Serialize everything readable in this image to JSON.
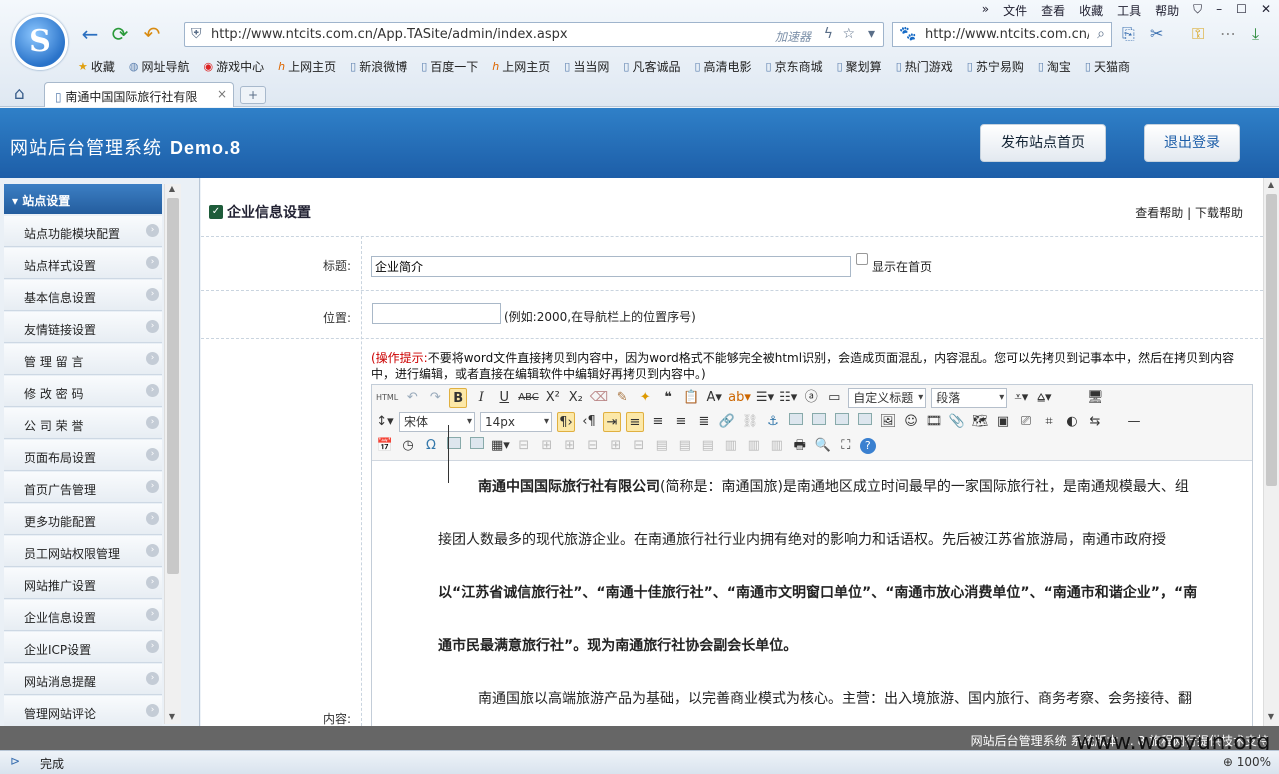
{
  "browser": {
    "menu": [
      "文件",
      "查看",
      "收藏",
      "工具",
      "帮助"
    ],
    "url": "http://www.ntcits.com.cn/App.TASite/admin/index.aspx",
    "accelerator": "加速器",
    "search_url": "http://www.ntcits.com.cn/",
    "favorites": [
      "收藏",
      "网址导航",
      "游戏中心",
      "上网主页",
      "新浪微博",
      "百度一下",
      "上网主页",
      "当当网",
      "凡客诚品",
      "高清电影",
      "京东商城",
      "聚划算",
      "热门游戏",
      "苏宁易购",
      "淘宝",
      "天猫商"
    ],
    "tab_title": "南通中国国际旅行社有限",
    "tab_close": "×",
    "new_tab": "+",
    "status": "完成",
    "zoom": "100%"
  },
  "app": {
    "title": "网站后台管理系统",
    "version": "Demo.8",
    "publish_button": "发布站点首页",
    "logout_button": "退出登录"
  },
  "sidebar": {
    "header": "站点设置",
    "items": [
      "站点功能模块配置",
      "站点样式设置",
      "基本信息设置",
      "友情链接设置",
      "管 理 留 言",
      "修 改 密 码",
      "公 司 荣 誉",
      "页面布局设置",
      "首页广告管理",
      "更多功能配置",
      "员工网站权限管理",
      "网站推广设置",
      "企业信息设置",
      "企业ICP设置",
      "网站消息提醒",
      "管理网站评论"
    ]
  },
  "main": {
    "section_title": "企业信息设置",
    "help_link": "查看帮助",
    "download_help_link": "下载帮助",
    "title_label": "标题:",
    "title_value": "企业简介",
    "show_home_label": "显示在首页",
    "position_label": "位置:",
    "position_value": "",
    "position_hint": "(例如:2000,在导航栏上的位置序号)",
    "tip_prefix": "(操作提示:",
    "tip_text": "不要将word文件直接拷贝到内容中，因为word格式不能够完全被html识别，会造成页面混乱，内容混乱。您可以先拷贝到记事本中，然后在拷贝到内容中，进行编辑，或者直接在编辑软件中编辑好再拷贝到内容中。)",
    "content_label": "内容:"
  },
  "editor": {
    "font_family": "宋体",
    "font_size": "14px",
    "custom_heading": "自定义标题",
    "paragraph": "段落",
    "html_label": "HTML",
    "paragraphs": [
      {
        "bold_lead": "南通中国国际旅行社有限公司",
        "text": "(简称是：南通国旅)是南通地区成立时间最早的一家国际旅行社，是南通规模最大、组接团人数最多的现代旅游企业。在南通旅行社行业内拥有绝对的影响力和话语权。先后被江苏省旅游局，南通市政府授"
      },
      {
        "text": "以“江苏省诚信旅行社”、“南通十佳旅行社”、“南通市文明窗口单位”、“南通市放心消费单位”、“南通市和谐企业”，“南通市民最满意旅行社”。现为南通旅行社协会副会长单位。"
      },
      {
        "text": "南通国旅以高端旅游产品为基础，以完善商业模式为核心。主营：出入境旅游、国内旅行、商务考察、会务接待、翻"
      }
    ]
  },
  "footer": {
    "text": "网站后台管理系统  系统版本  ...  8  旅程网行提供技术支持"
  },
  "watermark": "www.wooyun.org",
  "colors": {
    "header_blue": "#1d5ea8",
    "sidebar_head": "#2f6db0",
    "tip_red": "#cc0000",
    "footer_gray": "#666666"
  }
}
